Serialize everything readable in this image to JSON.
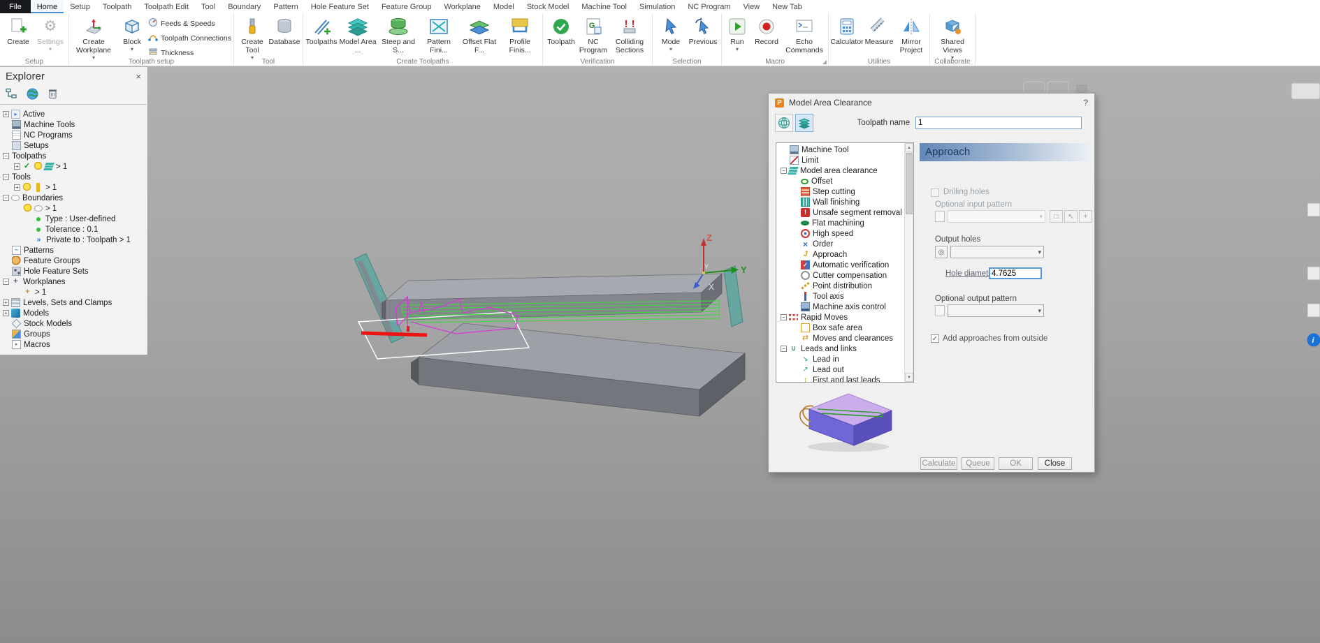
{
  "app": {
    "file_tab": "File",
    "tabs": [
      "Home",
      "Setup",
      "Toolpath",
      "Toolpath Edit",
      "Tool",
      "Boundary",
      "Pattern",
      "Hole Feature Set",
      "Feature Group",
      "Workplane",
      "Model",
      "Stock Model",
      "Machine Tool",
      "Simulation",
      "NC Program",
      "View",
      "New Tab"
    ],
    "active_tab": "Home"
  },
  "ribbon": {
    "groups": {
      "setup": {
        "label": "Setup",
        "create": "Create",
        "settings": "Settings"
      },
      "toolpath_setup": {
        "label": "Toolpath setup",
        "create_workplane": "Create Workplane",
        "block": "Block",
        "feeds_speeds": "Feeds & Speeds",
        "toolpath_connections": "Toolpath Connections",
        "thickness": "Thickness"
      },
      "tool": {
        "label": "Tool",
        "create_tool": "Create Tool",
        "database": "Database"
      },
      "create_toolpaths": {
        "label": "Create Toolpaths",
        "toolpaths": "Toolpaths",
        "model_area": "Model Area ...",
        "steep_shallow": "Steep and S...",
        "pattern_finishing": "Pattern Fini...",
        "offset_flat": "Offset Flat F...",
        "profile_finishing": "Profile Finis..."
      },
      "verification": {
        "label": "Verification",
        "toolpath": "Toolpath",
        "nc_program": "NC Program",
        "colliding_sections": "Colliding Sections"
      },
      "selection": {
        "label": "Selection",
        "mode": "Mode",
        "previous": "Previous"
      },
      "macro": {
        "label": "Macro",
        "run": "Run",
        "record": "Record",
        "echo_commands": "Echo Commands"
      },
      "utilities": {
        "label": "Utilities",
        "calculator": "Calculator",
        "measure": "Measure",
        "mirror_project": "Mirror Project"
      },
      "collaborate": {
        "label": "Collaborate",
        "shared_views": "Shared Views"
      }
    }
  },
  "explorer": {
    "title": "Explorer",
    "close": "×",
    "tree": [
      {
        "label": "Active",
        "level": 0,
        "expander": "plus",
        "icons": [
          "active"
        ]
      },
      {
        "label": "Machine Tools",
        "level": 0,
        "icons": [
          "machine-tools"
        ]
      },
      {
        "label": "NC Programs",
        "level": 0,
        "icons": [
          "nc-programs"
        ]
      },
      {
        "label": "Setups",
        "level": 0,
        "icons": [
          "setups"
        ]
      },
      {
        "label": "Toolpaths",
        "level": 0,
        "expander": "minus",
        "icons": []
      },
      {
        "label": "> 1",
        "level": 1,
        "expander": "plus",
        "icons": [
          "check",
          "bulb",
          "layers-teal"
        ]
      },
      {
        "label": "Tools",
        "level": 0,
        "expander": "minus",
        "icons": []
      },
      {
        "label": "> 1",
        "level": 1,
        "expander": "plus",
        "icons": [
          "bulb",
          "tool-yellow"
        ]
      },
      {
        "label": "Boundaries",
        "level": 0,
        "expander": "minus",
        "icons": [
          "boundary-oval"
        ]
      },
      {
        "label": "> 1",
        "level": 1,
        "icons": [
          "bulb",
          "boundary-oval"
        ]
      },
      {
        "label": "Type : User-defined",
        "level": 2,
        "icons": [
          "dot-green"
        ]
      },
      {
        "label": "Tolerance : 0.1",
        "level": 2,
        "icons": [
          "dot-green"
        ]
      },
      {
        "label": "Private to : Toolpath > 1",
        "level": 2,
        "icons": [
          "arrow-blue"
        ]
      },
      {
        "label": "Patterns",
        "level": 0,
        "icons": [
          "patterns"
        ]
      },
      {
        "label": "Feature Groups",
        "level": 0,
        "icons": [
          "feature-groups"
        ]
      },
      {
        "label": "Hole Feature Sets",
        "level": 0,
        "icons": [
          "hole-feature-sets"
        ]
      },
      {
        "label": "Workplanes",
        "level": 0,
        "expander": "minus",
        "icons": [
          "workplane"
        ]
      },
      {
        "label": "> 1",
        "level": 1,
        "icons": [
          "workplane-star"
        ]
      },
      {
        "label": "Levels, Sets and Clamps",
        "level": 0,
        "expander": "plus",
        "icons": [
          "levels"
        ]
      },
      {
        "label": "Models",
        "level": 0,
        "expander": "plus",
        "icons": [
          "models"
        ]
      },
      {
        "label": "Stock Models",
        "level": 0,
        "icons": [
          "stock-models"
        ]
      },
      {
        "label": "Groups",
        "level": 0,
        "icons": [
          "groups"
        ]
      },
      {
        "label": "Macros",
        "level": 0,
        "icons": [
          "macros"
        ]
      }
    ]
  },
  "viewport": {
    "axes": {
      "x": "X",
      "y": "Y",
      "z": "Z",
      "origin_y": "Y"
    }
  },
  "dialog": {
    "title": "Model Area Clearance",
    "help": "?",
    "toolpath_name_label": "Toolpath name",
    "toolpath_name_value": "1",
    "tree": [
      {
        "label": "Machine Tool",
        "level": 0,
        "icons": [
          "machine-tool"
        ]
      },
      {
        "label": "Limit",
        "level": 0,
        "icons": [
          "limit"
        ]
      },
      {
        "label": "Model area clearance",
        "level": 0,
        "expander": "minus",
        "icons": [
          "layers-teal"
        ]
      },
      {
        "label": "Offset",
        "level": 1,
        "icons": [
          "offset"
        ]
      },
      {
        "label": "Step cutting",
        "level": 1,
        "icons": [
          "step-cutting"
        ]
      },
      {
        "label": "Wall finishing",
        "level": 1,
        "icons": [
          "wall-finishing"
        ]
      },
      {
        "label": "Unsafe segment removal",
        "level": 1,
        "icons": [
          "unsafe-segment"
        ]
      },
      {
        "label": "Flat machining",
        "level": 1,
        "icons": [
          "flat-machining"
        ]
      },
      {
        "label": "High speed",
        "level": 1,
        "icons": [
          "high-speed"
        ]
      },
      {
        "label": "Order",
        "level": 1,
        "icons": [
          "order"
        ]
      },
      {
        "label": "Approach",
        "level": 1,
        "icons": [
          "approach"
        ]
      },
      {
        "label": "Automatic verification",
        "level": 1,
        "icons": [
          "auto-verification"
        ]
      },
      {
        "label": "Cutter compensation",
        "level": 1,
        "icons": [
          "cutter-compensation"
        ]
      },
      {
        "label": "Point distribution",
        "level": 1,
        "icons": [
          "point-distribution"
        ]
      },
      {
        "label": "Tool axis",
        "level": 1,
        "icons": [
          "tool-axis"
        ]
      },
      {
        "label": "Machine axis control",
        "level": 1,
        "icons": [
          "machine-axis"
        ]
      },
      {
        "label": "Rapid Moves",
        "level": 0,
        "expander": "minus",
        "icons": [
          "rapid-moves"
        ]
      },
      {
        "label": "Box safe area",
        "level": 1,
        "icons": [
          "box-safe-area"
        ]
      },
      {
        "label": "Moves and clearances",
        "level": 1,
        "icons": [
          "moves-clearances"
        ]
      },
      {
        "label": "Leads and links",
        "level": 0,
        "expander": "minus",
        "icons": [
          "leads-links"
        ]
      },
      {
        "label": "Lead in",
        "level": 1,
        "icons": [
          "lead-in"
        ]
      },
      {
        "label": "Lead out",
        "level": 1,
        "icons": [
          "lead-out"
        ]
      },
      {
        "label": "First and last leads",
        "level": 1,
        "icons": [
          "first-last-leads"
        ]
      }
    ],
    "page": {
      "header": "Approach",
      "drilling_holes_label": "Drilling holes",
      "optional_input_pattern_label": "Optional input pattern",
      "output_holes_label": "Output holes",
      "hole_diameter_label": "Hole diameter",
      "hole_diameter_value": "4.7625",
      "optional_output_pattern_label": "Optional output pattern",
      "add_approaches_label": "Add approaches from outside"
    },
    "buttons": {
      "calculate": "Calculate",
      "queue": "Queue",
      "ok": "OK",
      "close": "Close"
    }
  },
  "colors": {
    "accent_blue": "#3a7fc1",
    "teal": "#2ba8a0",
    "toolpath_green": "#3fd83f",
    "toolpath_magenta": "#d838d8",
    "toolpath_red": "#ee1212",
    "axis_x": "#3a5fd0",
    "axis_y": "#1e8f1e",
    "axis_z": "#c23030"
  }
}
